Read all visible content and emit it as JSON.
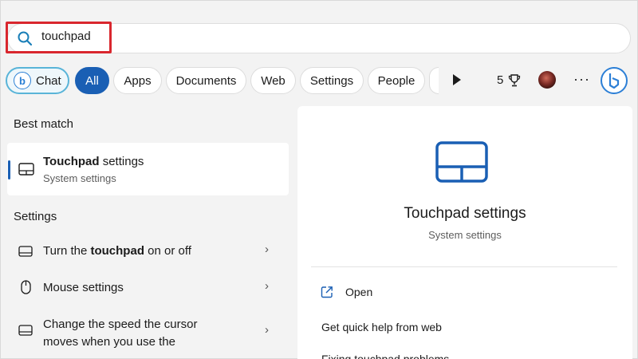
{
  "search": {
    "query": "touchpad"
  },
  "filters": {
    "chat_label": "Chat",
    "all_label": "All",
    "apps_label": "Apps",
    "documents_label": "Documents",
    "web_label": "Web",
    "settings_label": "Settings",
    "people_label": "People",
    "rewards_count": "5"
  },
  "results": {
    "best_match_heading": "Best match",
    "best_match": {
      "title_bold": "Touchpad",
      "title_rest": " settings",
      "subtitle": "System settings"
    },
    "settings_heading": "Settings",
    "items": [
      {
        "pre": "Turn the ",
        "bold": "touchpad",
        "post": " on or off",
        "line2": ""
      },
      {
        "pre": "Mouse settings",
        "bold": "",
        "post": "",
        "line2": ""
      },
      {
        "pre": "Change the speed the cursor",
        "bold": "",
        "post": "",
        "line2": "moves when you use the"
      }
    ]
  },
  "preview": {
    "title": "Touchpad settings",
    "subtitle": "System settings",
    "open_label": "Open",
    "help_label": "Get quick help from web",
    "partial_label": "Fixing touchpad problems"
  },
  "colors": {
    "accent": "#1a5fb4",
    "highlight_border": "#d9272e",
    "bing_blue": "#2c7fd6"
  }
}
